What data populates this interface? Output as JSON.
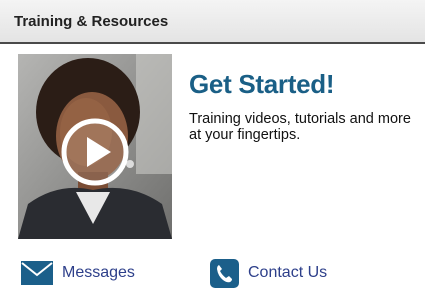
{
  "header": {
    "title": "Training & Resources"
  },
  "promo": {
    "headline": "Get Started!",
    "description": "Training videos, tutorials and more at your fingertips.",
    "video_icon": "play-icon"
  },
  "links": {
    "messages": {
      "label": "Messages",
      "icon": "envelope-icon"
    },
    "contact": {
      "label": "Contact Us",
      "icon": "phone-icon"
    }
  },
  "colors": {
    "accent": "#1a5f86",
    "link": "#2d3f8a",
    "icon": "#1b5f8a",
    "header_border": "#4a4a4a"
  }
}
